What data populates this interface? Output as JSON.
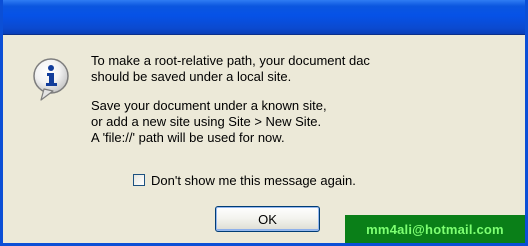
{
  "dialog": {
    "message_lines": [
      "To make a root-relative path, your document dac",
      "should be saved under a local site.",
      "Save your document under a known site,",
      "or add a new site using Site > New Site.",
      "A 'file://' path will be used for now."
    ],
    "checkbox_label": "Don't show me this message again.",
    "checkbox_checked": false,
    "ok_label": "OK",
    "icon": "info-icon"
  },
  "watermark": {
    "text": "mm4ali@hotmail.com"
  },
  "colors": {
    "titlebar": "#0b56df",
    "dialog_bg": "#ece9d8",
    "watermark_bg": "#0a7f18",
    "watermark_text": "#7dff72"
  }
}
